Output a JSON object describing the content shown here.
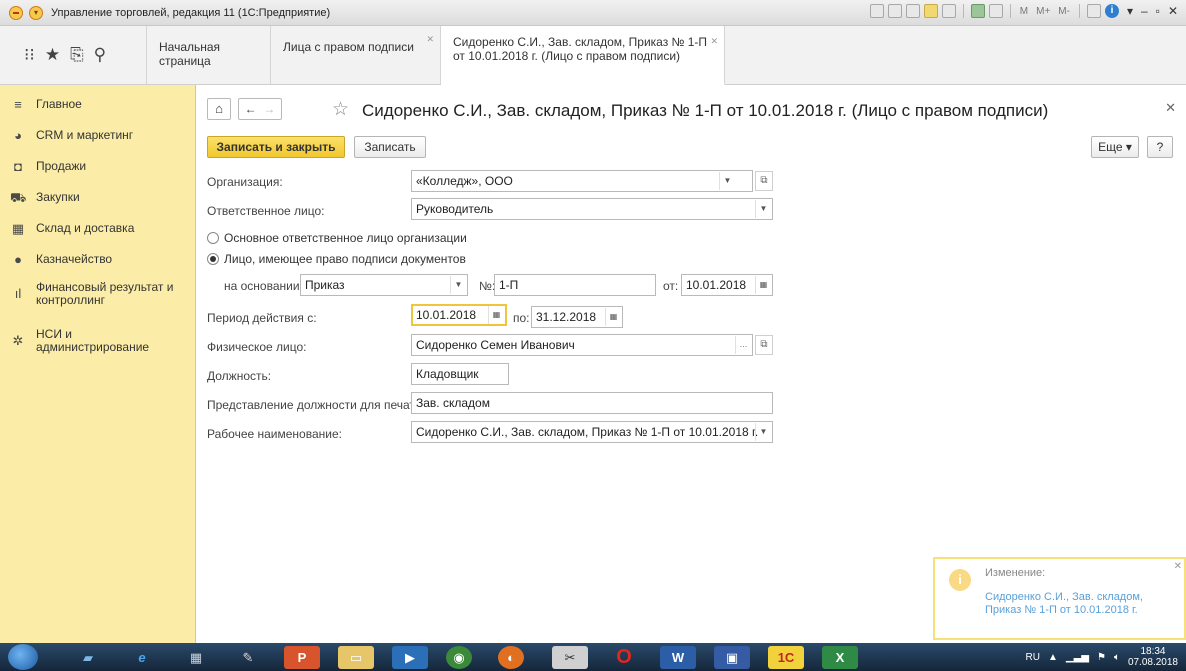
{
  "window": {
    "title": "Управление торговлей, редакция 11 (1С:Предприятие)",
    "tray_labels": [
      "M",
      "M+",
      "M-"
    ]
  },
  "tabs": [
    {
      "label": "Начальная страница"
    },
    {
      "label": "Лица с правом подписи"
    },
    {
      "label_line1": "Сидоренко С.И., Зав. складом, Приказ № 1-П",
      "label_line2": "от 10.01.2018 г. (Лицо с правом подписи)"
    }
  ],
  "sidebar": {
    "items": [
      {
        "label": "Главное",
        "icon": "menu-icon"
      },
      {
        "label": "CRM и маркетинг",
        "icon": "pie-icon"
      },
      {
        "label": "Продажи",
        "icon": "bag-icon"
      },
      {
        "label": "Закупки",
        "icon": "cart-icon"
      },
      {
        "label": "Склад и доставка",
        "icon": "warehouse-icon"
      },
      {
        "label": "Казначейство",
        "icon": "coin-icon"
      },
      {
        "label": "Финансовый результат и контроллинг",
        "icon": "bar-chart-icon"
      },
      {
        "label": "НСИ и администрирование",
        "icon": "gear-icon"
      }
    ]
  },
  "doc": {
    "title": "Сидоренко С.И., Зав. складом, Приказ № 1-П от 10.01.2018 г. (Лицо с правом подписи)",
    "save_close": "Записать и закрыть",
    "save": "Записать",
    "more": "Еще",
    "help": "?"
  },
  "form": {
    "org_label": "Организация:",
    "org_value": "«Колледж», ООО",
    "resp_label": "Ответственное лицо:",
    "resp_value": "Руководитель",
    "radio1": "Основное ответственное лицо организации",
    "radio2": "Лицо, имеющее право подписи документов",
    "basis_label": "на основании:",
    "basis_value": "Приказ",
    "num_label": "№:",
    "num_value": "1-П",
    "from_label": "от:",
    "from_value": "10.01.2018",
    "period_label": "Период действия с:",
    "period_from": "10.01.2018",
    "period_to_label": "по:",
    "period_to": "31.12.2018",
    "person_label": "Физическое лицо:",
    "person_value": "Сидоренко Семен Иванович",
    "position_label": "Должность:",
    "position_value": "Кладовщик",
    "print_label": "Представление должности для печати:",
    "print_value": "Зав. складом",
    "work_label": "Рабочее наименование:",
    "work_value": "Сидоренко С.И., Зав. складом, Приказ № 1-П от 10.01.2018 г."
  },
  "notification": {
    "head": "Изменение:",
    "text": "Сидоренко С.И., Зав. складом, Приказ № 1-П от 10.01.2018 г."
  },
  "taskbar": {
    "lang": "RU",
    "time": "18:34",
    "date": "07.08.2018"
  }
}
